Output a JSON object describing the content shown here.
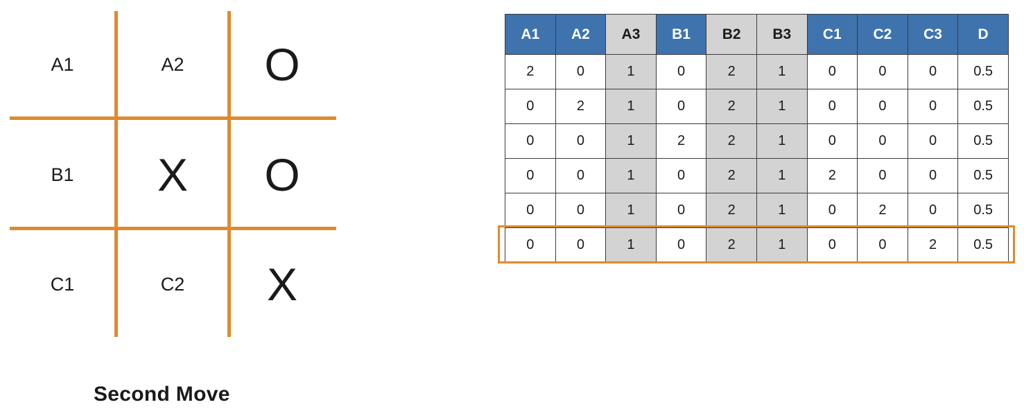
{
  "board": {
    "cells": [
      [
        {
          "label": "A1",
          "mark": ""
        },
        {
          "label": "A2",
          "mark": ""
        },
        {
          "label": "",
          "mark": "O"
        }
      ],
      [
        {
          "label": "B1",
          "mark": ""
        },
        {
          "label": "",
          "mark": "X"
        },
        {
          "label": "",
          "mark": "O"
        }
      ],
      [
        {
          "label": "C1",
          "mark": ""
        },
        {
          "label": "C2",
          "mark": ""
        },
        {
          "label": "",
          "mark": "X"
        }
      ]
    ],
    "line_color": "#e08a2e"
  },
  "caption": "Second Move",
  "table": {
    "headers": [
      "A1",
      "A2",
      "A3",
      "B1",
      "B2",
      "B3",
      "C1",
      "C2",
      "C3",
      "D"
    ],
    "highlighted_columns": [
      "A3",
      "B2",
      "B3"
    ],
    "rows": [
      [
        "2",
        "0",
        "1",
        "0",
        "2",
        "1",
        "0",
        "0",
        "0",
        "0.5"
      ],
      [
        "0",
        "2",
        "1",
        "0",
        "2",
        "1",
        "0",
        "0",
        "0",
        "0.5"
      ],
      [
        "0",
        "0",
        "1",
        "2",
        "2",
        "1",
        "0",
        "0",
        "0",
        "0.5"
      ],
      [
        "0",
        "0",
        "1",
        "0",
        "2",
        "1",
        "2",
        "0",
        "0",
        "0.5"
      ],
      [
        "0",
        "0",
        "1",
        "0",
        "2",
        "1",
        "0",
        "2",
        "0",
        "0.5"
      ],
      [
        "0",
        "0",
        "1",
        "0",
        "2",
        "1",
        "0",
        "0",
        "2",
        "0.5"
      ]
    ],
    "highlighted_row": 5,
    "header_color": "#3f73ad",
    "gray_color": "#d3d3d3",
    "highlight_color": "#e08a2e"
  }
}
